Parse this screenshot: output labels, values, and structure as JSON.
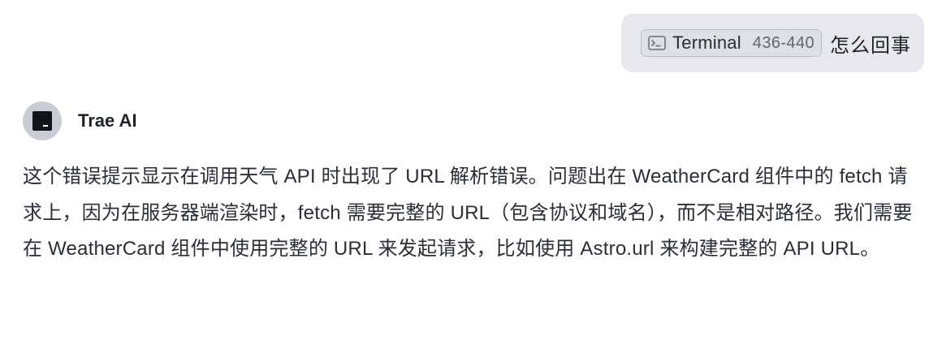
{
  "user_message": {
    "attachment": {
      "icon": "terminal-icon",
      "label": "Terminal",
      "range": "436-440"
    },
    "text": "怎么回事"
  },
  "assistant": {
    "avatar_icon": "trae-logo-icon",
    "name": "Trae AI",
    "message": "这个错误提示显示在调用天气 API 时出现了 URL 解析错误。问题出在 WeatherCard 组件中的 fetch 请求上，因为在服务器端渲染时，fetch 需要完整的 URL（包含协议和域名），而不是相对路径。我们需要在 WeatherCard 组件中使用完整的 URL 来发起请求，比如使用 Astro.url 来构建完整的 API URL。"
  },
  "colors": {
    "bubble_bg": "#e6e8ec",
    "chip_border": "#b9bec6",
    "text": "#1f2329",
    "avatar_bg": "#c9ccd2"
  }
}
